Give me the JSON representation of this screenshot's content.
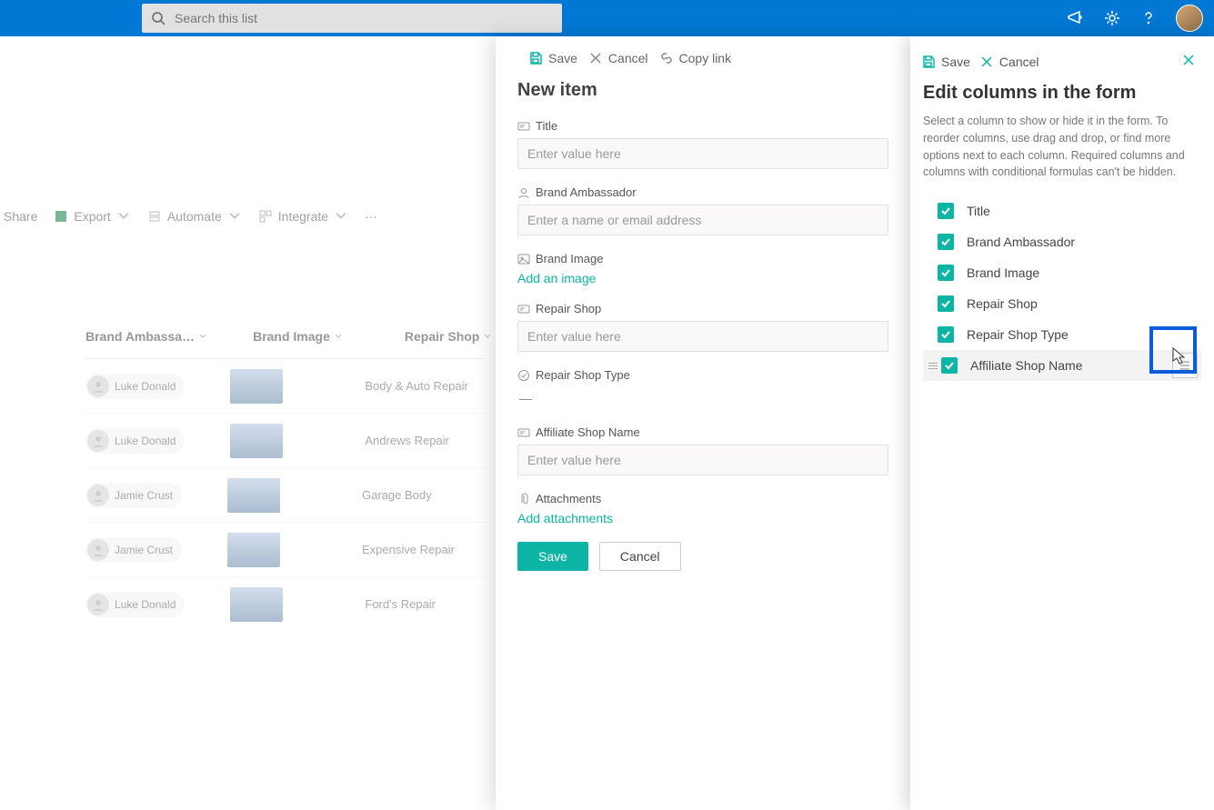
{
  "header": {
    "search_placeholder": "Search this list"
  },
  "bg": {
    "cmd_share": "Share",
    "cmd_export": "Export",
    "cmd_automate": "Automate",
    "cmd_integrate": "Integrate",
    "col_ambassador": "Brand Ambassa…",
    "col_image": "Brand Image",
    "col_shop": "Repair Shop",
    "rows": [
      {
        "person": "Luke Donald",
        "shop": "Body & Auto Repair"
      },
      {
        "person": "Luke Donald",
        "shop": "Andrews Repair"
      },
      {
        "person": "Jamie Crust",
        "shop": "Garage Body"
      },
      {
        "person": "Jamie Crust",
        "shop": "Expensive Repair"
      },
      {
        "person": "Luke Donald",
        "shop": "Ford's Repair"
      }
    ]
  },
  "mid": {
    "cmd_save": "Save",
    "cmd_cancel": "Cancel",
    "cmd_copy": "Copy link",
    "title": "New item",
    "fields": {
      "title_label": "Title",
      "title_ph": "Enter value here",
      "ambassador_label": "Brand Ambassador",
      "ambassador_ph": "Enter a name or email address",
      "image_label": "Brand Image",
      "image_link": "Add an image",
      "shop_label": "Repair Shop",
      "shop_ph": "Enter value here",
      "shoptype_label": "Repair Shop Type",
      "shoptype_value": "—",
      "affiliate_label": "Affiliate Shop Name",
      "affiliate_ph": "Enter value here",
      "attach_label": "Attachments",
      "attach_link": "Add attachments"
    },
    "save_btn": "Save",
    "cancel_btn": "Cancel"
  },
  "right": {
    "cmd_save": "Save",
    "cmd_cancel": "Cancel",
    "title": "Edit columns in the form",
    "desc": "Select a column to show or hide it in the form. To reorder columns, use drag and drop, or find more options next to each column. Required columns and columns with conditional formulas can't be hidden.",
    "columns": [
      {
        "label": "Title"
      },
      {
        "label": "Brand Ambassador"
      },
      {
        "label": "Brand Image"
      },
      {
        "label": "Repair Shop"
      },
      {
        "label": "Repair Shop Type"
      },
      {
        "label": "Affiliate Shop Name"
      }
    ]
  }
}
